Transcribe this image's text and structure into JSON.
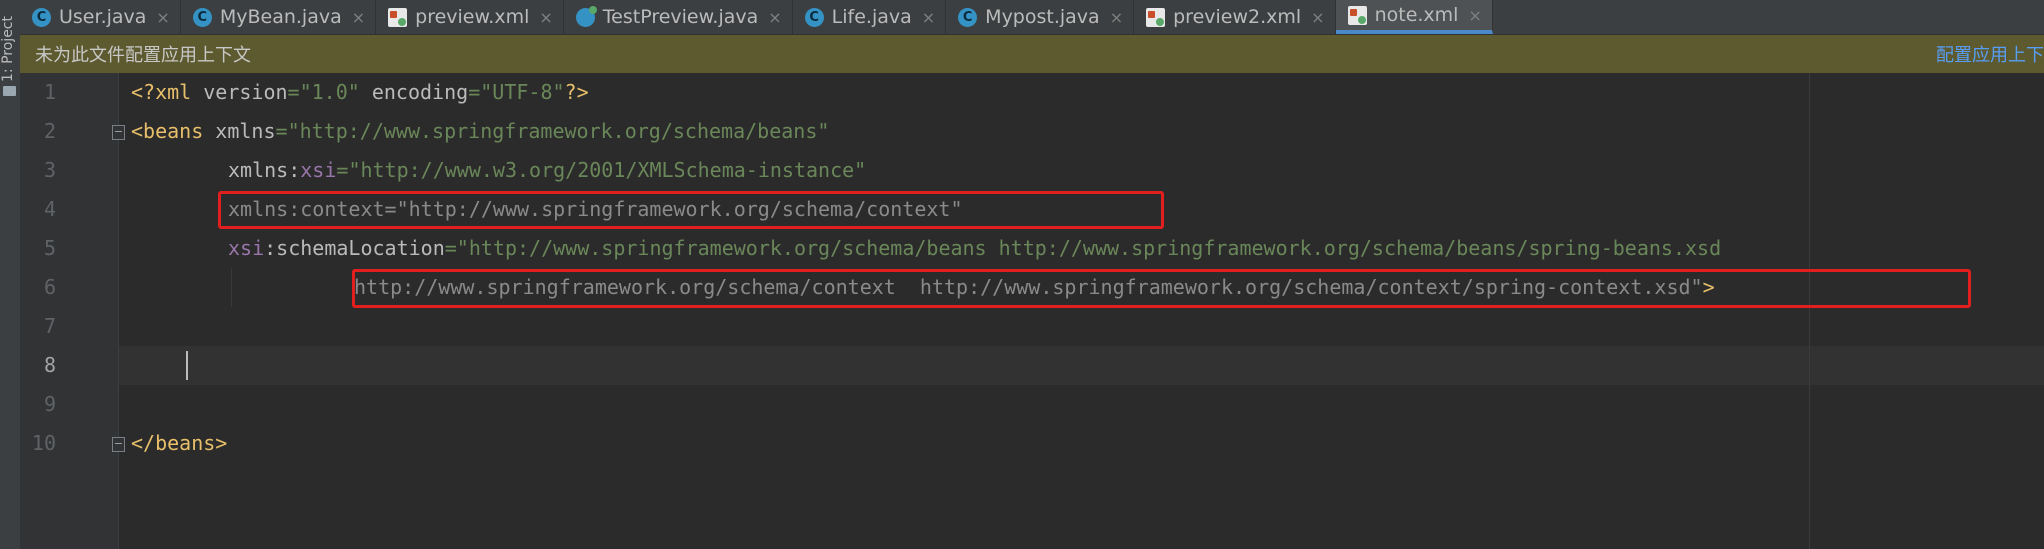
{
  "project_strip": {
    "label": "1: Project",
    "icon": "folder-icon"
  },
  "tabs": [
    {
      "label": "User.java",
      "icon": "class",
      "active": false
    },
    {
      "label": "MyBean.java",
      "icon": "class",
      "active": false
    },
    {
      "label": "preview.xml",
      "icon": "xml",
      "active": false
    },
    {
      "label": "TestPreview.java",
      "icon": "test",
      "active": false
    },
    {
      "label": "Life.java",
      "icon": "class",
      "active": false
    },
    {
      "label": "Mypost.java",
      "icon": "class",
      "active": false
    },
    {
      "label": "preview2.xml",
      "icon": "xml",
      "active": false
    },
    {
      "label": "note.xml",
      "icon": "xml",
      "active": true
    }
  ],
  "tab_close_glyph": "×",
  "class_icon_letter": "C",
  "notification": {
    "message": "未为此文件配置应用上下文",
    "action": "配置应用上下"
  },
  "editor": {
    "line_numbers": [
      "1",
      "2",
      "3",
      "4",
      "5",
      "6",
      "7",
      "8",
      "9",
      "10"
    ],
    "current_line": "8",
    "lines": {
      "l1": {
        "open": "<?xml ",
        "a1": "version",
        "eq1": "=",
        "v1": "\"1.0\"",
        "a2": " encoding",
        "eq2": "=",
        "v2": "\"UTF-8\"",
        "close": "?>"
      },
      "l2": {
        "open": "<beans ",
        "a1": "xmlns",
        "eq1": "=",
        "v1": "\"http://www.springframework.org/schema/beans\""
      },
      "l3": {
        "a1": "xmlns",
        "colon": ":",
        "ns": "xsi",
        "eq1": "=",
        "v1": "\"http://www.w3.org/2001/XMLSchema-instance\""
      },
      "l4": {
        "text": "xmlns:context=\"http://www.springframework.org/schema/context\""
      },
      "l5": {
        "ns": "xsi",
        "colon": ":",
        "a1": "schemaLocation",
        "eq1": "=",
        "v1": "\"http://www.springframework.org/schema/beans http://www.springframework.org/schema/beans/spring-beans.xsd"
      },
      "l6": {
        "text": "http://www.springframework.org/schema/context  http://www.springframework.org/schema/context/spring-context.xsd\"",
        "close": ">"
      },
      "l10": {
        "close_tag": "</beans>"
      }
    }
  },
  "colors": {
    "highlight_box": "#e21f1f",
    "notification_bg": "#5c5a2e",
    "active_tab_underline": "#4a88c7"
  }
}
